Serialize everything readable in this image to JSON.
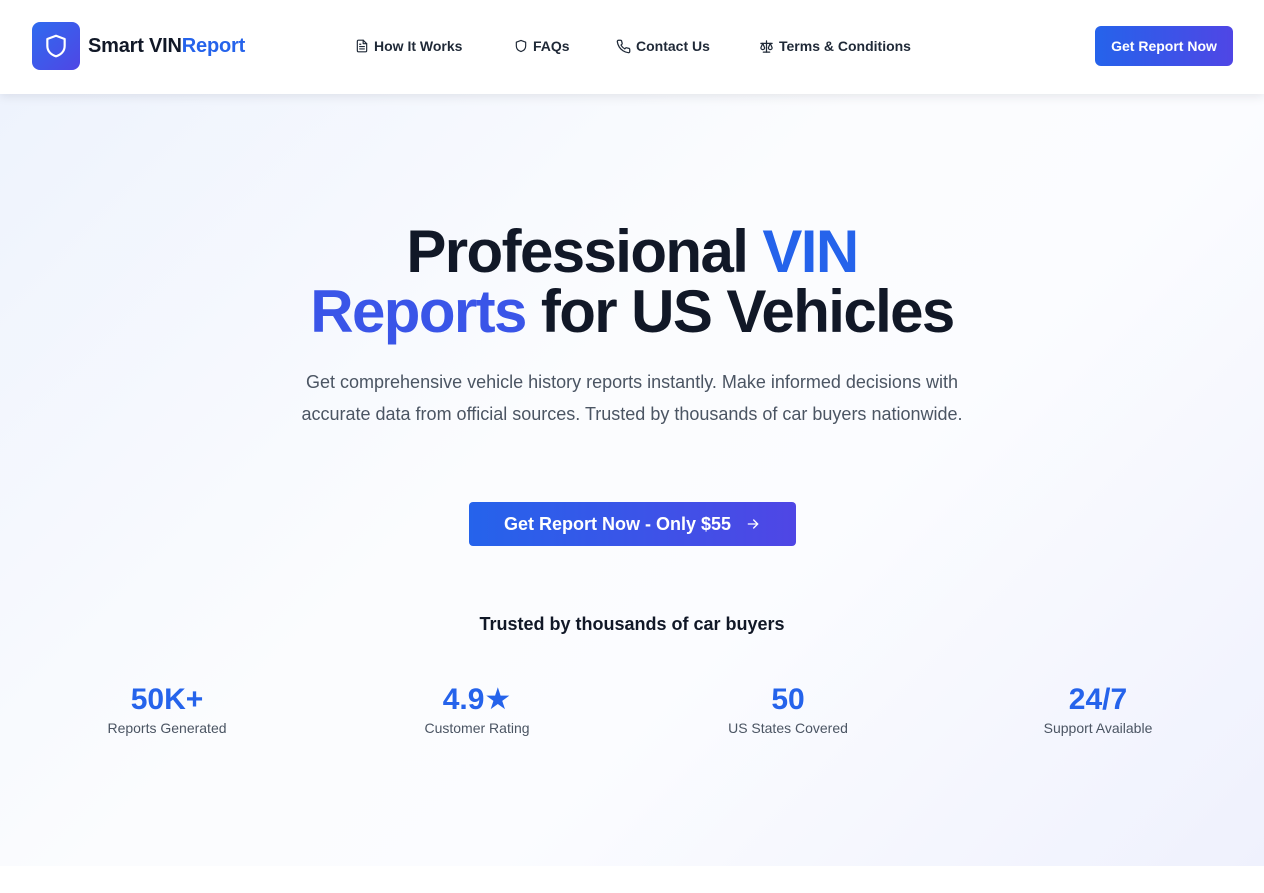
{
  "header": {
    "logo": {
      "text_part1": "Smart VIN",
      "text_part2": "Report",
      "icon": "shield-icon"
    },
    "nav": [
      {
        "label": "How It Works",
        "icon": "document-icon"
      },
      {
        "label": "FAQs",
        "icon": "shield-icon"
      },
      {
        "label": "Contact Us",
        "icon": "phone-icon"
      },
      {
        "label": "Terms & Conditions",
        "icon": "scale-icon"
      }
    ],
    "cta_label": "Get Report Now"
  },
  "hero": {
    "headline": {
      "part1": "Professional ",
      "part2": "VIN",
      "part3": "Reports",
      "part4": " for US Vehicles"
    },
    "subtext": "Get comprehensive vehicle history reports instantly. Make informed decisions with accurate data from official sources. Trusted by thousands of car buyers nationwide.",
    "cta_label": "Get Report Now - Only $55",
    "cta_icon": "arrow-right-icon",
    "trusted_heading": "Trusted by thousands of car buyers",
    "stats": [
      {
        "value": "50K+",
        "label": "Reports Generated"
      },
      {
        "value": "4.9★",
        "label": "Customer Rating"
      },
      {
        "value": "50",
        "label": "US States Covered"
      },
      {
        "value": "24/7",
        "label": "Support Available"
      }
    ]
  },
  "colors": {
    "accent": "#2563eb",
    "accent_secondary": "#4f46e5",
    "text_dark": "#111827",
    "text_muted": "#4b5563"
  }
}
